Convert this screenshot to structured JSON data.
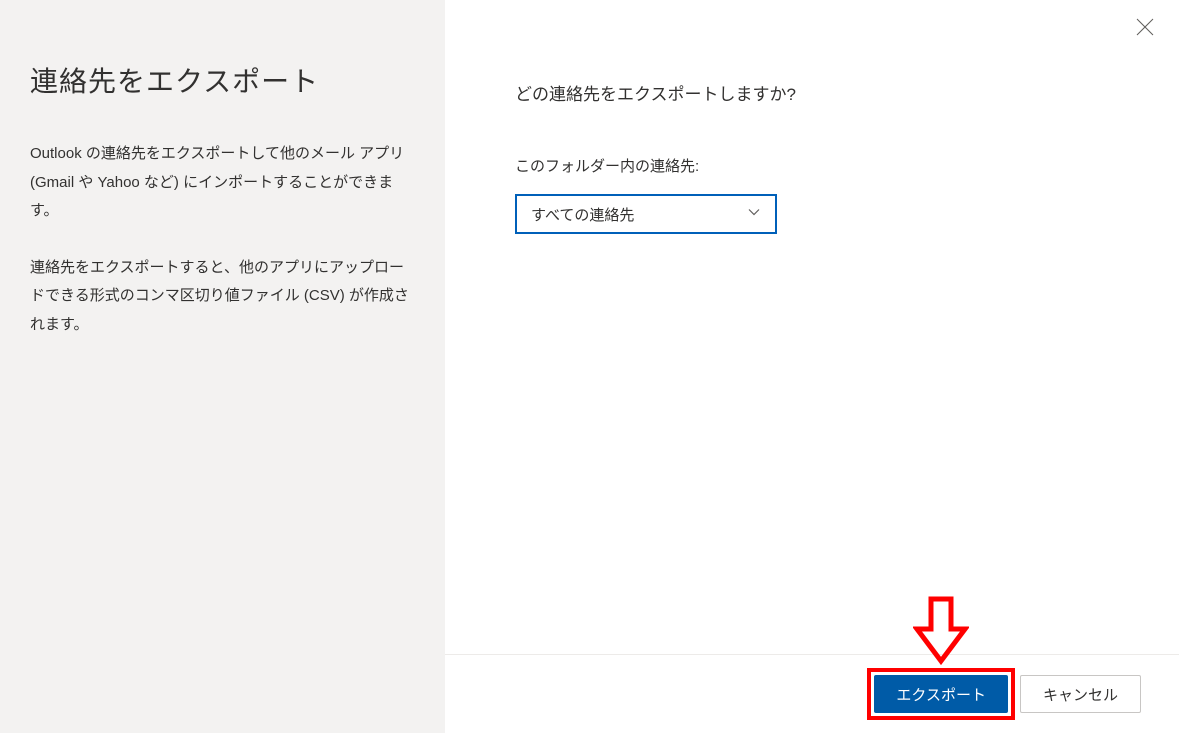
{
  "sidebar": {
    "title": "連絡先をエクスポート",
    "paragraph1": "Outlook の連絡先をエクスポートして他のメール アプリ (Gmail や Yahoo など) にインポートすることができます。",
    "paragraph2": "連絡先をエクスポートすると、他のアプリにアップロードできる形式のコンマ区切り値ファイル (CSV) が作成されます。"
  },
  "main": {
    "heading": "どの連絡先をエクスポートしますか?",
    "folder_label": "このフォルダー内の連絡先:",
    "dropdown_value": "すべての連絡先"
  },
  "footer": {
    "export_label": "エクスポート",
    "cancel_label": "キャンセル"
  }
}
